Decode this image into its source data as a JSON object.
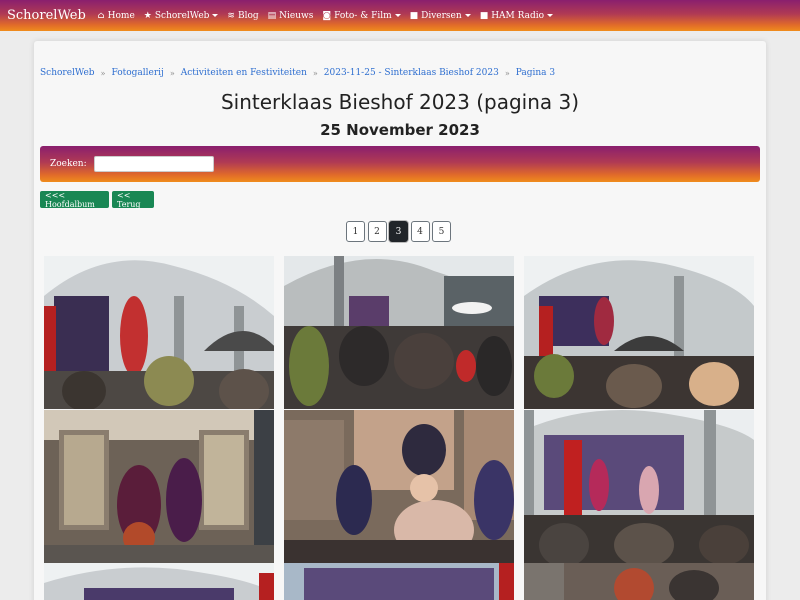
{
  "nav": {
    "brand": "SchorelWeb",
    "items": [
      {
        "label": "Home",
        "icon": "home-icon",
        "glyph": "⌂",
        "dropdown": false
      },
      {
        "label": "SchorelWeb",
        "icon": "star-icon",
        "glyph": "★",
        "dropdown": true
      },
      {
        "label": "Blog",
        "icon": "rss-icon",
        "glyph": "≋",
        "dropdown": false
      },
      {
        "label": "Nieuws",
        "icon": "newspaper-icon",
        "glyph": "▤",
        "dropdown": false
      },
      {
        "label": "Foto- & Film",
        "icon": "camera-icon",
        "glyph": "◙",
        "dropdown": true
      },
      {
        "label": "Diversen",
        "icon": "folder-icon",
        "glyph": "■",
        "dropdown": true
      },
      {
        "label": "HAM Radio",
        "icon": "folder-icon",
        "glyph": "■",
        "dropdown": true
      }
    ]
  },
  "breadcrumb": [
    "SchorelWeb",
    "Fotogallerij",
    "Activiteiten en Festiviteiten",
    "2023-11-25 - Sinterklaas Bieshof 2023",
    "Pagina 3"
  ],
  "page": {
    "title": "Sinterklaas Bieshof 2023 (pagina 3)",
    "subtitle": "25 November 2023"
  },
  "search": {
    "label": "Zoeken:",
    "value": ""
  },
  "buttons": {
    "main_album": "<<< Hoofdalbum",
    "back": "<< Terug"
  },
  "pagination": {
    "pages": [
      "1",
      "2",
      "3",
      "4",
      "5"
    ],
    "current": "3"
  },
  "colors": {
    "brand_gradient_start": "#8a1f6e",
    "brand_gradient_end": "#f08c1c",
    "button_green": "#198754",
    "link": "#2f6fd0"
  }
}
